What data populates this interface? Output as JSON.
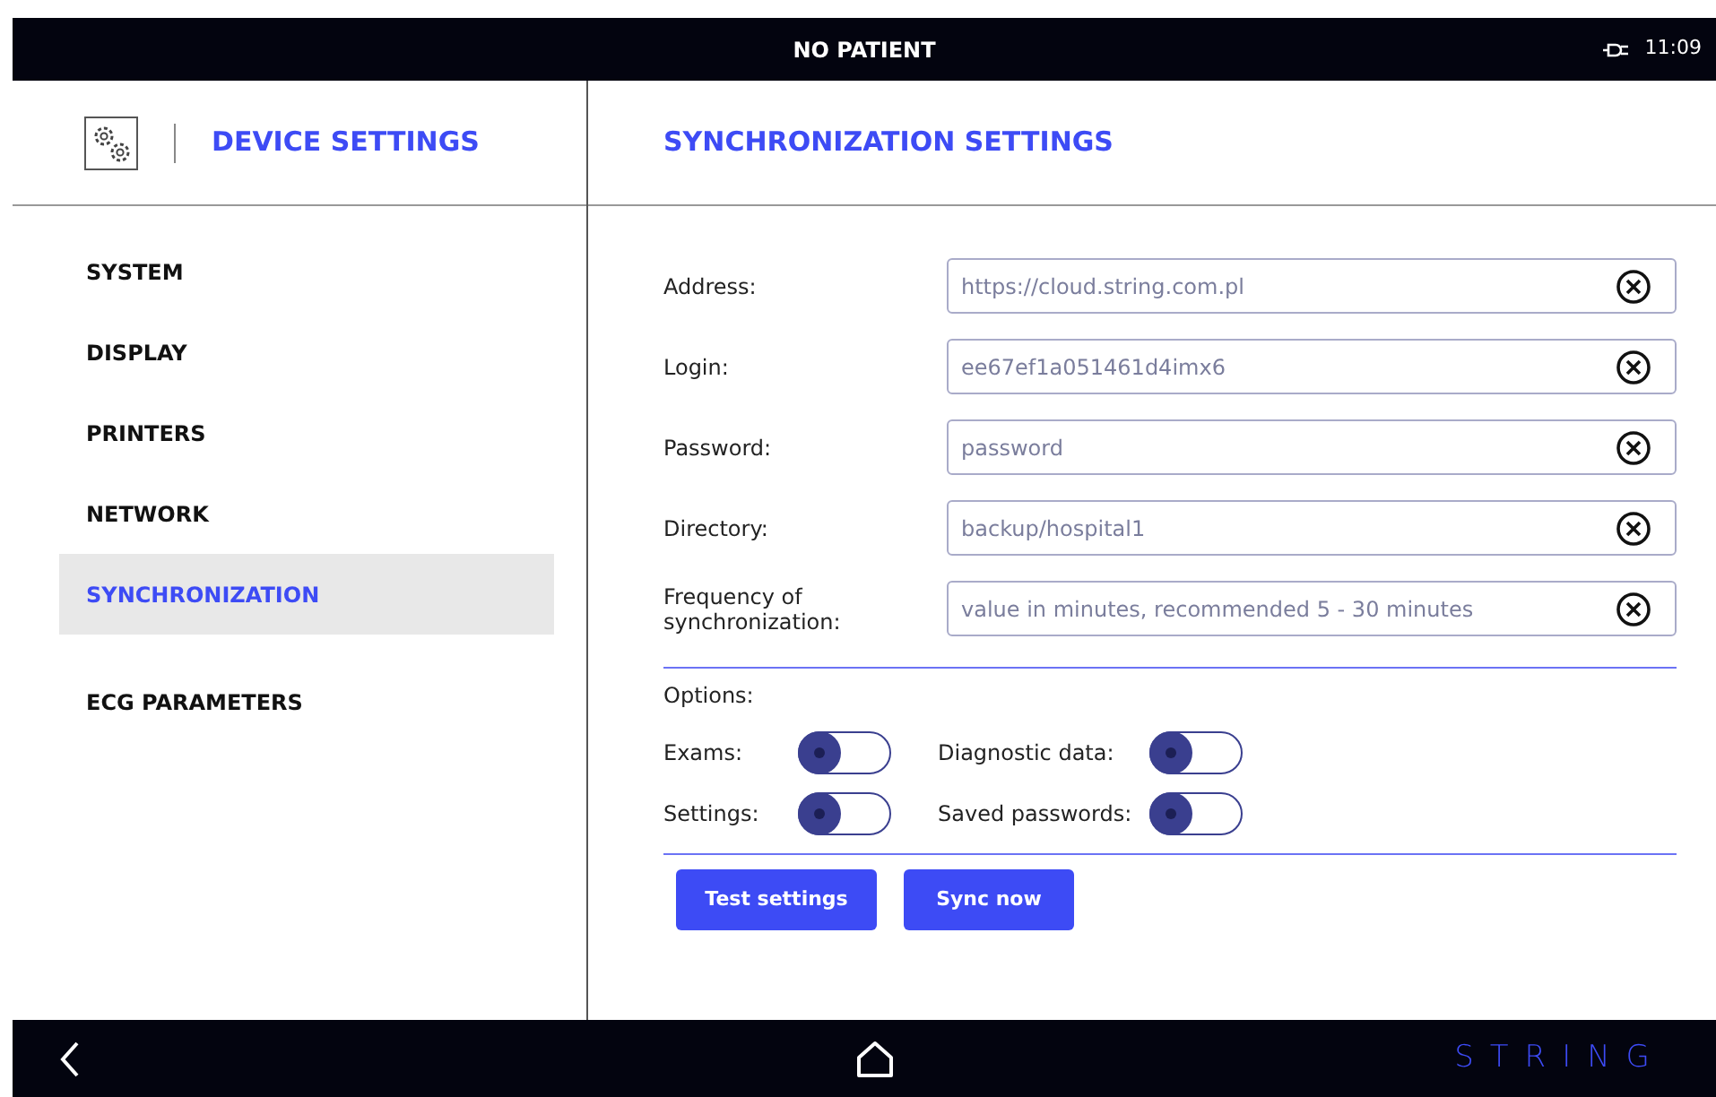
{
  "status_bar": {
    "title": "NO PATIENT",
    "time": "11:09"
  },
  "sidebar": {
    "title": "DEVICE SETTINGS",
    "items": [
      {
        "label": "SYSTEM",
        "selected": false
      },
      {
        "label": "DISPLAY",
        "selected": false
      },
      {
        "label": "PRINTERS",
        "selected": false
      },
      {
        "label": "NETWORK",
        "selected": false
      },
      {
        "label": "SYNCHRONIZATION",
        "selected": true
      },
      {
        "label": "ECG PARAMETERS",
        "selected": false
      }
    ]
  },
  "panel": {
    "title": "SYNCHRONIZATION SETTINGS",
    "fields": [
      {
        "label": "Address:",
        "value": "https://cloud.string.com.pl"
      },
      {
        "label": "Login:",
        "value": "ee67ef1a051461d4imx6"
      },
      {
        "label": "Password:",
        "placeholder": "password"
      },
      {
        "label": "Directory:",
        "value": "backup/hospital1"
      },
      {
        "label": "Frequency of synchronization:",
        "placeholder": "value in minutes, recommended 5 - 30 minutes"
      }
    ],
    "options_title": "Options:",
    "options": [
      {
        "label": "Exams:",
        "on": false
      },
      {
        "label": "Diagnostic data:",
        "on": false
      },
      {
        "label": "Settings:",
        "on": false
      },
      {
        "label": "Saved passwords:",
        "on": false
      }
    ],
    "buttons": [
      "Test settings",
      "Sync now"
    ]
  },
  "nav_bar": {
    "logo": "STRING"
  }
}
